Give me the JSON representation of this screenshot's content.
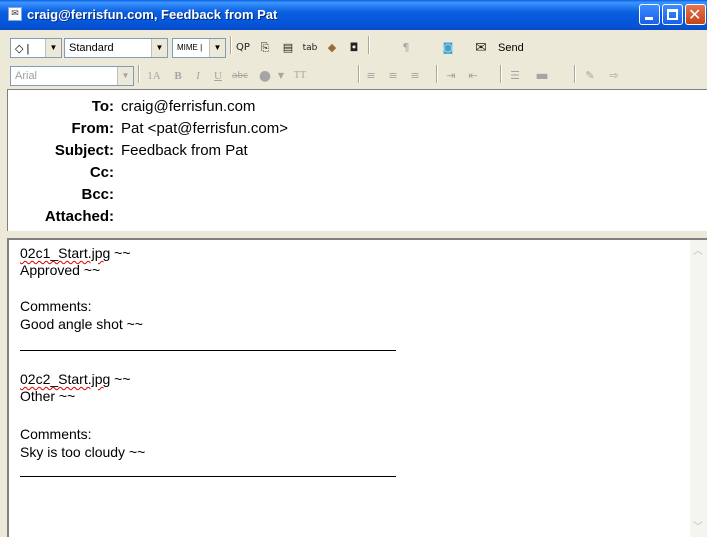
{
  "window": {
    "title": "craig@ferrisfun.com, Feedback from Pat"
  },
  "toolbar": {
    "priority_combo": "◇ |",
    "style_combo": "Standard",
    "mime_combo": "MIME |",
    "qp_label": "QP",
    "tab_label": "tab",
    "send_label": "Send",
    "font_combo": "Arial",
    "font_size_label": "1A",
    "bold_label": "B",
    "italic_label": "I",
    "underline_label": "U",
    "strike_label": "abc",
    "tt_label": "TT"
  },
  "header": {
    "fields": [
      {
        "label": "To:",
        "value": "craig@ferrisfun.com"
      },
      {
        "label": "From:",
        "value": "Pat <pat@ferrisfun.com>"
      },
      {
        "label": "Subject:",
        "value": "Feedback from Pat"
      },
      {
        "label": "Cc:",
        "value": ""
      },
      {
        "label": "Bcc:",
        "value": ""
      },
      {
        "label": "Attached:",
        "value": ""
      }
    ]
  },
  "body": {
    "blocks": [
      {
        "file": "02c1_Start.jpg",
        "suffix": " ~~",
        "status": "Approved ~~",
        "comments_label": "Comments:",
        "comment": "Good angle shot ~~"
      },
      {
        "file": "02c2_Start.jpg",
        "suffix": " ~~",
        "status": "Other ~~",
        "comments_label": "Comments:",
        "comment": "Sky is too cloudy ~~"
      }
    ]
  }
}
